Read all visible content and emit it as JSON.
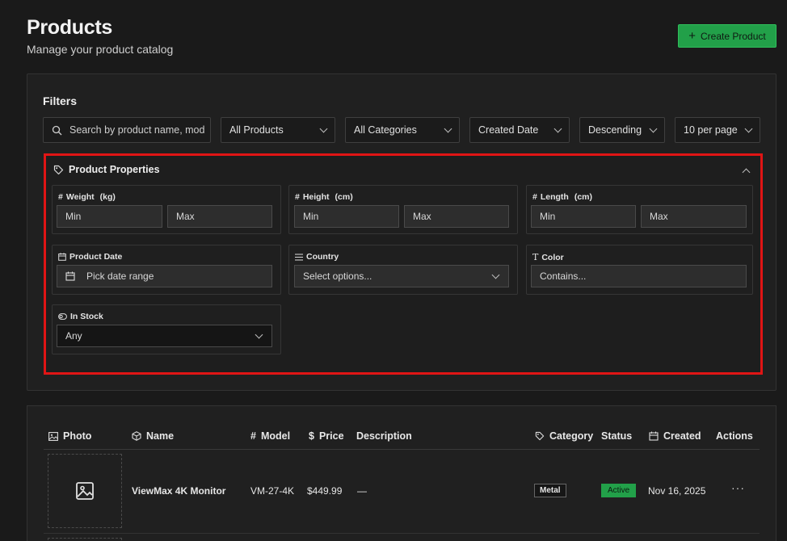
{
  "header": {
    "title": "Products",
    "subtitle": "Manage your product catalog",
    "create_label": "Create Product"
  },
  "filters": {
    "title": "Filters",
    "search_placeholder": "Search by product name, mod",
    "products_select": "All Products",
    "categories_select": "All Categories",
    "sort_field": "Created Date",
    "sort_order": "Descending",
    "per_page": "10 per page"
  },
  "properties": {
    "title": "Product Properties",
    "weight": {
      "label": "Weight",
      "unit": "(kg)",
      "min": "Min",
      "max": "Max"
    },
    "height": {
      "label": "Height",
      "unit": "(cm)",
      "min": "Min",
      "max": "Max"
    },
    "length": {
      "label": "Length",
      "unit": "(cm)",
      "min": "Min",
      "max": "Max"
    },
    "product_date": {
      "label": "Product Date",
      "placeholder": "Pick date range"
    },
    "country": {
      "label": "Country",
      "placeholder": "Select options..."
    },
    "color": {
      "label": "Color",
      "placeholder": "Contains..."
    },
    "in_stock": {
      "label": "In Stock",
      "value": "Any"
    }
  },
  "table": {
    "columns": {
      "photo": "Photo",
      "name": "Name",
      "model": "Model",
      "price": "Price",
      "description": "Description",
      "category": "Category",
      "status": "Status",
      "created": "Created",
      "actions": "Actions"
    },
    "rows": [
      {
        "name": "ViewMax 4K Monitor",
        "model": "VM-27-4K",
        "price": "$449.99",
        "description": "—",
        "category": "Metal",
        "status": "Active",
        "created": "Nov 16, 2025",
        "actions": "···"
      }
    ]
  },
  "colors": {
    "accent": "#22a049",
    "highlight_border": "#e01515",
    "background": "#1a1a1a"
  }
}
